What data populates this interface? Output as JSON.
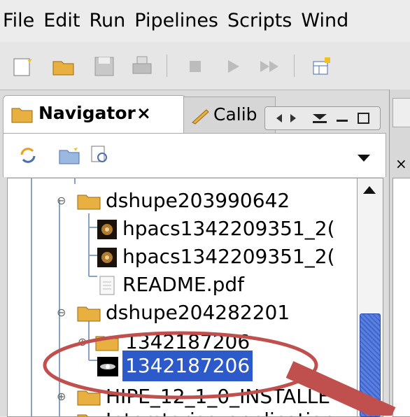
{
  "menu": [
    "File",
    "Edit",
    "Run",
    "Pipelines",
    "Scripts",
    "Wind"
  ],
  "toolbar": {
    "icons": [
      "new-project-icon",
      "open-folder-icon",
      "save-icon",
      "print-icon",
      "stop-icon",
      "run-icon",
      "run-all-icon",
      "window-icon"
    ]
  },
  "tabs": {
    "navigator": {
      "label": "Navigator",
      "close": "×"
    },
    "calib": {
      "label": "Calib"
    }
  },
  "tree": {
    "rows": [
      {
        "label": "dshupe203990642",
        "type": "folder",
        "expanded": true
      },
      {
        "label": "hpacs1342209351_2(",
        "type": "image"
      },
      {
        "label": "hpacs1342209351_2(",
        "type": "image"
      },
      {
        "label": "README.pdf",
        "type": "file"
      },
      {
        "label": "dshupe204282201",
        "type": "folder",
        "expanded": true
      },
      {
        "label": "1342187206",
        "type": "folder",
        "expanded": false
      },
      {
        "label": "1342187206",
        "type": "image",
        "selected": true
      },
      {
        "label": "HIPE_12_1_0_INSTALLE",
        "type": "folder",
        "expanded": false
      },
      {
        "label": "Interstarise_application",
        "type": "folder",
        "expanded": false
      }
    ]
  },
  "colors": {
    "selection": "#2c5aca",
    "highlight_ellipse": "#c0504d",
    "folder": "#e8b040"
  }
}
